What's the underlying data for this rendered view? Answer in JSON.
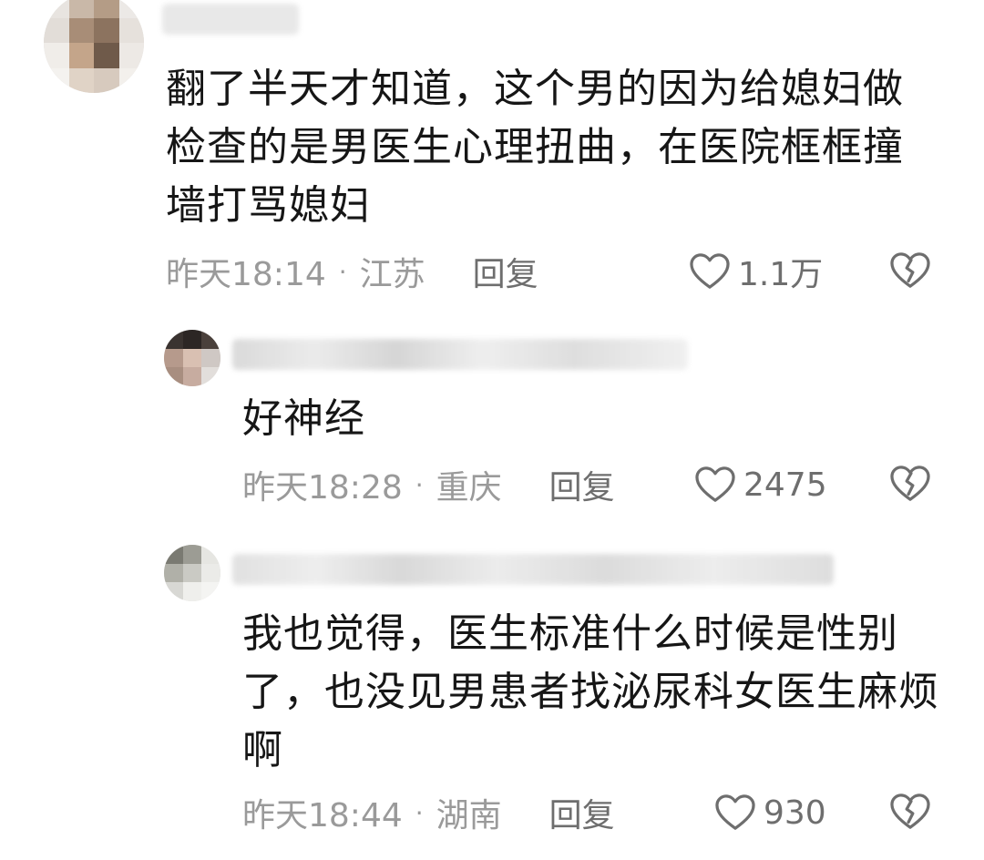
{
  "comments": [
    {
      "text": "翻了半天才知道，这个男的因为给媳妇做\n检查的是男医生心理扭曲，在医院框框撞\n墙打骂媳妇",
      "time": "昨天18:14",
      "location": "江苏",
      "reply_label": "回复",
      "like_count": "1.1万"
    },
    {
      "text": "好神经",
      "time": "昨天18:28",
      "location": "重庆",
      "reply_label": "回复",
      "like_count": "2475"
    },
    {
      "text": "我也觉得，医生标准什么时候是性别\n了，也没见男患者找泌尿科女医生麻烦\n啊",
      "time": "昨天18:44",
      "location": "湖南",
      "reply_label": "回复",
      "like_count": "930"
    }
  ],
  "separator": "·",
  "icons": {
    "like": "heart-outline-icon",
    "dislike": "broken-heart-icon"
  },
  "colors": {
    "text": "#161616",
    "meta": "#9a9a9a",
    "action": "#6e6e6e"
  }
}
